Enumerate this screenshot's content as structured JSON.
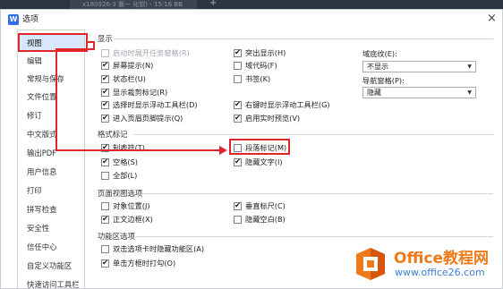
{
  "browser": {
    "tab_text": "x180926-3 赢一 化软) - 15:16 BB",
    "new_tab_icon": "plus-icon"
  },
  "dialog": {
    "title": "选项",
    "close_label": "×"
  },
  "sidebar": {
    "items": [
      {
        "label": "视图",
        "active": true
      },
      {
        "label": "编辑"
      },
      {
        "label": "常规与保存"
      },
      {
        "label": "文件位置"
      },
      {
        "label": "修订"
      },
      {
        "label": "中文版式"
      },
      {
        "label": "输出PDF"
      },
      {
        "label": "用户信息"
      },
      {
        "label": "打印"
      },
      {
        "label": "拼写检查"
      },
      {
        "label": "安全性"
      },
      {
        "label": "信任中心"
      },
      {
        "label": "自定义功能区"
      },
      {
        "label": "快速访问工具栏"
      }
    ]
  },
  "display": {
    "heading": "显示",
    "col1": [
      {
        "label": "启动时展开任务窗格(R)",
        "checked": false,
        "disabled": true
      },
      {
        "label": "屏幕提示(N)",
        "checked": true
      },
      {
        "label": "状态栏(U)",
        "checked": true
      },
      {
        "label": "显示裁剪标记(R)",
        "checked": true
      },
      {
        "label": "选择时显示浮动工具栏(D)",
        "checked": true
      },
      {
        "label": "进入页眉页脚提示(Q)",
        "checked": true
      }
    ],
    "col2": [
      {
        "label": "突出显示(H)",
        "checked": true
      },
      {
        "label": "域代码(F)",
        "checked": false
      },
      {
        "label": "书签(K)",
        "checked": false
      },
      {
        "label": "右键时显示浮动工具栏(G)",
        "checked": true
      },
      {
        "label": "启用实时预览(V)",
        "checked": true
      }
    ],
    "field_shading": {
      "label": "域底纹(E):",
      "value": "不显示"
    },
    "nav_pane": {
      "label": "导航窗格(P):",
      "value": "隐藏"
    }
  },
  "format_marks": {
    "heading": "格式标记",
    "col1": [
      {
        "label": "制表符(T)",
        "checked": true
      },
      {
        "label": "空格(S)",
        "checked": true
      },
      {
        "label": "全部(L)",
        "checked": false
      }
    ],
    "col2": [
      {
        "label": "段落标记(M)",
        "checked": false
      },
      {
        "label": "隐藏文字(I)",
        "checked": true
      }
    ]
  },
  "page_view": {
    "heading": "页面视图选项",
    "col1": [
      {
        "label": "对象位置(J)",
        "checked": false
      },
      {
        "label": "正文边框(X)",
        "checked": true
      }
    ],
    "col2": [
      {
        "label": "垂直标尺(C)",
        "checked": true
      },
      {
        "label": "隐藏空白(B)",
        "checked": false
      }
    ]
  },
  "ribbon": {
    "heading": "功能区选项",
    "col1": [
      {
        "label": "双击选项卡时隐藏功能区(A)",
        "checked": false
      },
      {
        "label": "单击方框时打勾(O)",
        "checked": true
      }
    ]
  },
  "watermark": {
    "line1": "Office教程网",
    "line2": "www.office26.com",
    "colors": {
      "orange": "#ef7a1a",
      "blue": "#3b7fd4"
    }
  },
  "colors": {
    "annotation_red": "#e0262b",
    "active_item_bg": "#d8e7fb",
    "logo_blue": "#2f6ee7"
  }
}
